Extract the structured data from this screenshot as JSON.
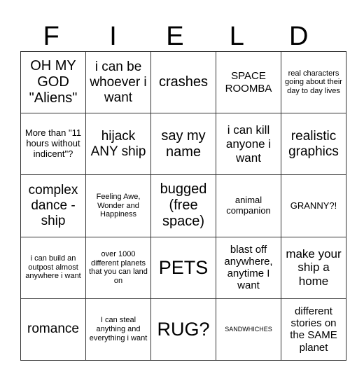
{
  "header": {
    "letters": [
      "F",
      "I",
      "E",
      "L",
      "D"
    ]
  },
  "grid": {
    "rows": [
      [
        "OH MY GOD \"Aliens\"",
        "i can be whoever i want",
        "crashes",
        "SPACE ROOMBA",
        "real characters going about their day to day lives"
      ],
      [
        "More than \"11 hours without indicent\"?",
        "hijack ANY ship",
        "say my name",
        "i can kill anyone i want",
        "realistic graphics"
      ],
      [
        "complex dance - ship",
        "Feeling Awe, Wonder and Happiness",
        "bugged (free space)",
        "animal companion",
        "GRANNY?!"
      ],
      [
        "i can build an outpost almost anywhere i want",
        "over 1000 different planets that you can land on",
        "PETS",
        "blast off anywhere, anytime I want",
        "make your ship a home"
      ],
      [
        "romance",
        "I can steal anything and everything i want",
        "RUG?",
        "SANDWHICHES",
        "different stories on the SAME planet"
      ]
    ]
  }
}
